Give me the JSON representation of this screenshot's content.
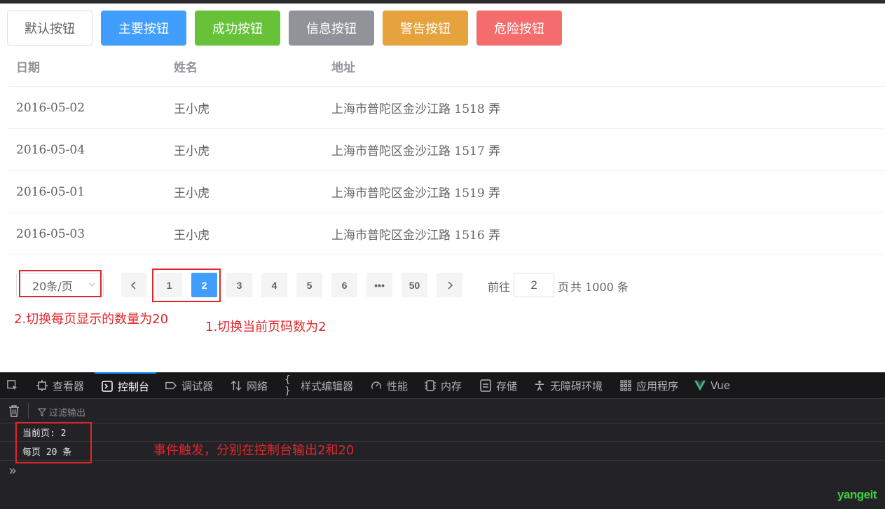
{
  "buttons": [
    "默认按钮",
    "主要按钮",
    "成功按钮",
    "信息按钮",
    "警告按钮",
    "危险按钮"
  ],
  "table": {
    "headers": [
      "日期",
      "姓名",
      "地址"
    ],
    "rows": [
      [
        "2016-05-02",
        "王小虎",
        "上海市普陀区金沙江路 1518 弄"
      ],
      [
        "2016-05-04",
        "王小虎",
        "上海市普陀区金沙江路 1517 弄"
      ],
      [
        "2016-05-01",
        "王小虎",
        "上海市普陀区金沙江路 1519 弄"
      ],
      [
        "2016-05-03",
        "王小虎",
        "上海市普陀区金沙江路 1516 弄"
      ]
    ]
  },
  "pagination": {
    "page_size": "20条/页",
    "pages": [
      "1",
      "2",
      "3",
      "4",
      "5",
      "6",
      "•••",
      "50"
    ],
    "current_page": "2",
    "goto_label": "前往",
    "goto_value": "2",
    "page_suffix": "页",
    "total_text": "共 1000 条"
  },
  "annotations": {
    "page_size": "2.切换每页显示的数量为20",
    "current_page": "1.切换当前页码数为2",
    "console": "事件触发，分别在控制台输出2和20"
  },
  "devtools": {
    "tabs": [
      "查看器",
      "控制台",
      "调试器",
      "网络",
      "样式编辑器",
      "性能",
      "内存",
      "存储",
      "无障碍环境",
      "应用程序",
      "Vue"
    ],
    "active_tab": "控制台",
    "filter_placeholder": "过滤输出",
    "console_lines": [
      "当前页: 2",
      "每页 20 条"
    ],
    "prompt": "»"
  },
  "watermark": "yangeit",
  "colors": {
    "primary": "#409eff",
    "success": "#67c23a",
    "info": "#909399",
    "warning": "#e6a23c",
    "danger": "#f56c6c",
    "annotation_red": "#e0262a"
  }
}
